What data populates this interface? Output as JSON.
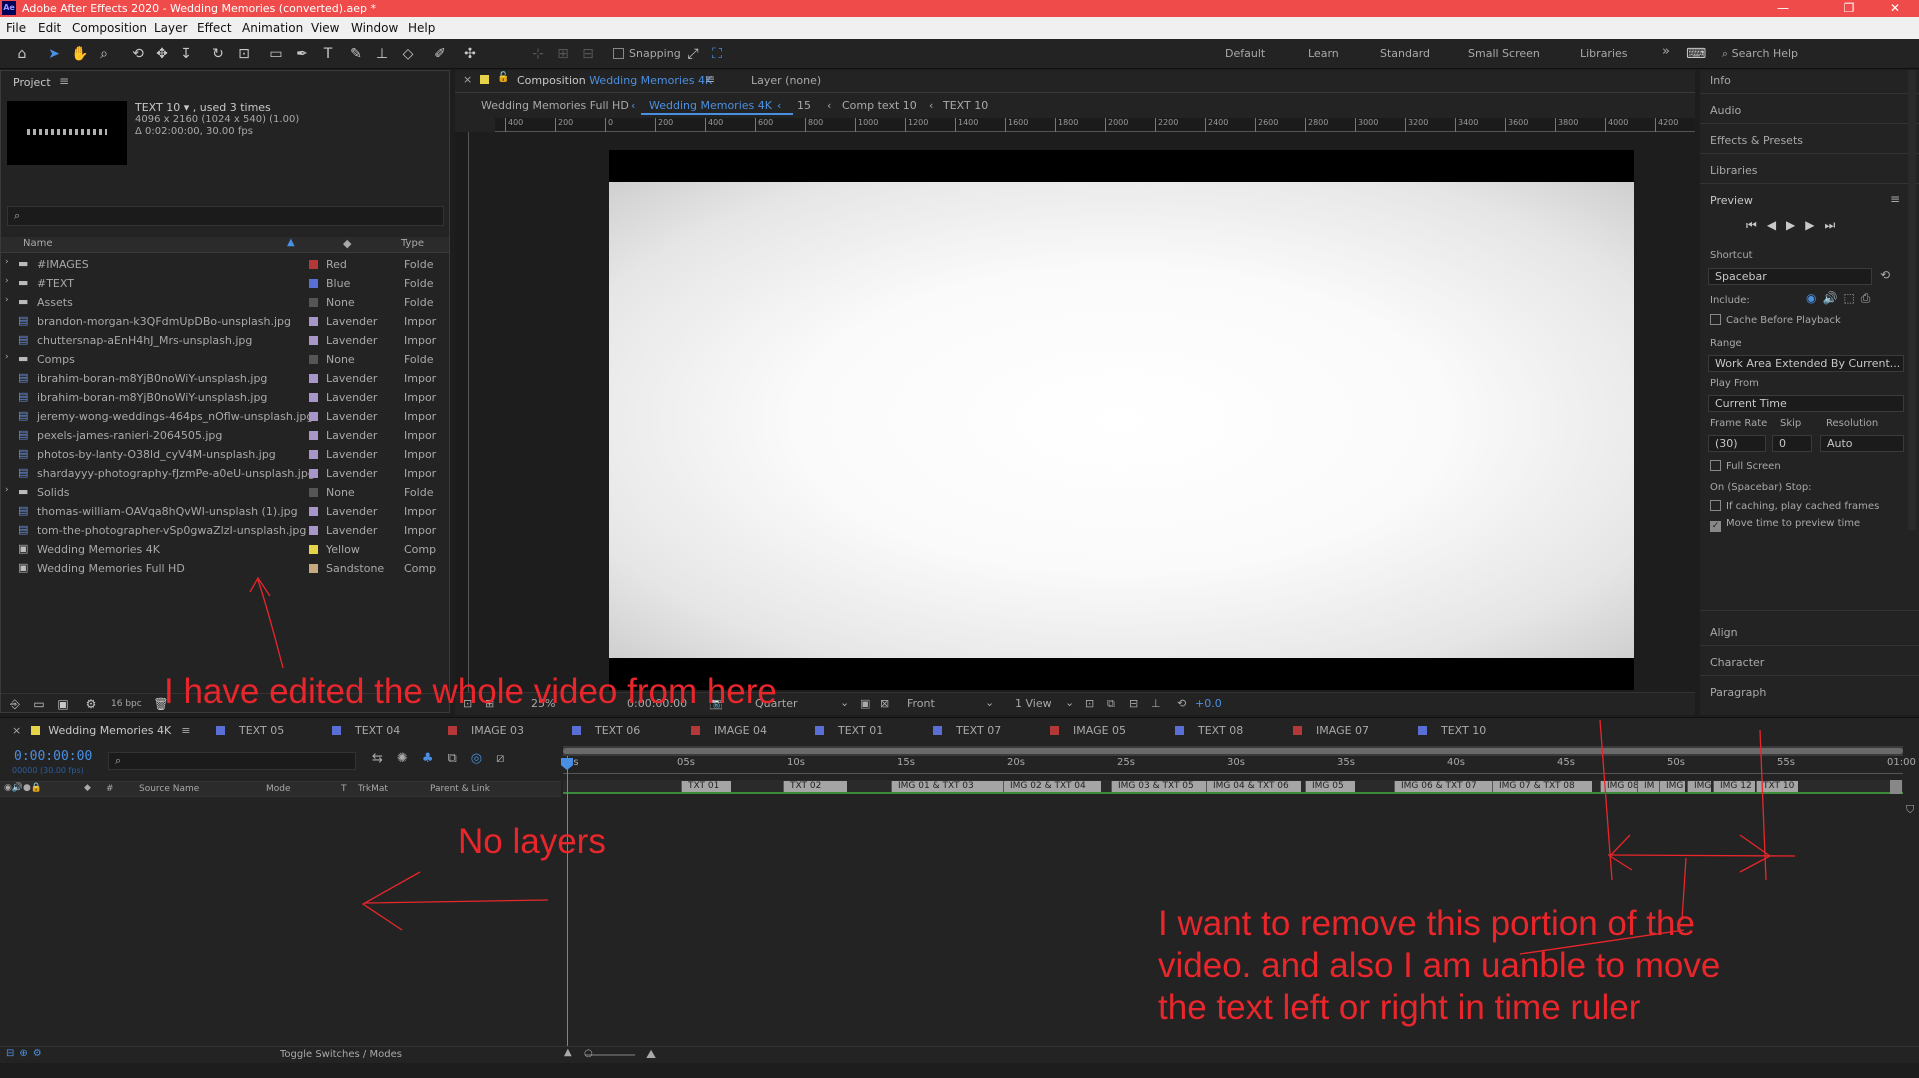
{
  "window": {
    "title": "Adobe After Effects 2020 - Wedding Memories (converted).aep *",
    "app_badge": "Ae",
    "minimize": "—",
    "maximize": "❐",
    "close": "✕"
  },
  "menu": [
    "File",
    "Edit",
    "Composition",
    "Layer",
    "Effect",
    "Animation",
    "View",
    "Window",
    "Help"
  ],
  "toolbar": {
    "snapping_label": "Snapping",
    "workspaces": [
      "Default",
      "Learn",
      "Standard",
      "Small Screen",
      "Libraries"
    ],
    "more": "»",
    "search_placeholder": "Search Help"
  },
  "project": {
    "panel_title": "Project",
    "selected_name": "TEXT 10",
    "selected_used": ", used 3 times",
    "selected_size": "4096 x 2160  (1024 x 540) (1.00)",
    "selected_duration": "Δ 0:02:00:00, 30.00 fps",
    "columns": {
      "name": "Name",
      "type": "Type"
    },
    "items": [
      {
        "name": "#IMAGES",
        "label": "Red",
        "type": "Folde",
        "kind": "folder",
        "color": "#b53838"
      },
      {
        "name": "#TEXT",
        "label": "Blue",
        "type": "Folde",
        "kind": "folder",
        "color": "#5a6fd6"
      },
      {
        "name": "Assets",
        "label": "None",
        "type": "Folde",
        "kind": "folder",
        "color": "#555555"
      },
      {
        "name": "brandon-morgan-k3QFdmUpDBo-unsplash.jpg",
        "label": "Lavender",
        "type": "Impor",
        "kind": "file",
        "color": "#a896c8"
      },
      {
        "name": "chuttersnap-aEnH4hJ_Mrs-unsplash.jpg",
        "label": "Lavender",
        "type": "Impor",
        "kind": "file",
        "color": "#a896c8"
      },
      {
        "name": "Comps",
        "label": "None",
        "type": "Folde",
        "kind": "folder",
        "color": "#555555"
      },
      {
        "name": "ibrahim-boran-m8YjB0noWiY-unsplash.jpg",
        "label": "Lavender",
        "type": "Impor",
        "kind": "file",
        "color": "#a896c8"
      },
      {
        "name": "ibrahim-boran-m8YjB0noWiY-unsplash.jpg",
        "label": "Lavender",
        "type": "Impor",
        "kind": "file",
        "color": "#a896c8"
      },
      {
        "name": "jeremy-wong-weddings-464ps_nOflw-unsplash.jpg",
        "label": "Lavender",
        "type": "Impor",
        "kind": "file",
        "color": "#a896c8"
      },
      {
        "name": "pexels-james-ranieri-2064505.jpg",
        "label": "Lavender",
        "type": "Impor",
        "kind": "file",
        "color": "#a896c8"
      },
      {
        "name": "photos-by-lanty-O38ld_cyV4M-unsplash.jpg",
        "label": "Lavender",
        "type": "Impor",
        "kind": "file",
        "color": "#a896c8"
      },
      {
        "name": "shardayyy-photography-fJzmPe-a0eU-unsplash.jpg",
        "label": "Lavender",
        "type": "Impor",
        "kind": "file",
        "color": "#a896c8"
      },
      {
        "name": "Solids",
        "label": "None",
        "type": "Folde",
        "kind": "folder",
        "color": "#555555"
      },
      {
        "name": "thomas-william-OAVqa8hQvWI-unsplash (1).jpg",
        "label": "Lavender",
        "type": "Impor",
        "kind": "file",
        "color": "#a896c8"
      },
      {
        "name": "tom-the-photographer-vSp0gwaZlzI-unsplash.jpg",
        "label": "Lavender",
        "type": "Impor",
        "kind": "file",
        "color": "#a896c8"
      },
      {
        "name": "Wedding Memories 4K",
        "label": "Yellow",
        "type": "Comp",
        "kind": "comp",
        "color": "#e6d34a"
      },
      {
        "name": "Wedding Memories Full HD",
        "label": "Sandstone",
        "type": "Comp",
        "kind": "comp",
        "color": "#c4aa7e"
      }
    ],
    "bpc": "16 bpc"
  },
  "composition": {
    "tab_label": "Composition",
    "comp_name": "Wedding Memories 4K",
    "layer_label": "Layer (none)",
    "breadcrumbs": [
      "Wedding Memories Full HD",
      "Wedding Memories 4K",
      "15",
      "Comp text 10",
      "TEXT 10"
    ],
    "ruler_ticks": [
      "400",
      "200",
      "0",
      "200",
      "400",
      "600",
      "800",
      "1000",
      "1200",
      "1400",
      "1600",
      "1800",
      "2000",
      "2200",
      "2400",
      "2600",
      "2800",
      "3000",
      "3200",
      "3400",
      "3600",
      "3800",
      "4000",
      "4200"
    ],
    "zoom": "25%",
    "timecode": "0:00:00:00",
    "resolution": "Quarter",
    "view": "Front",
    "views": "1 View",
    "exposure": "+0.0"
  },
  "right_panel": {
    "top_items": [
      "Info",
      "Audio",
      "Effects & Presets",
      "Libraries"
    ],
    "preview_title": "Preview",
    "shortcut_label": "Shortcut",
    "shortcut_value": "Spacebar",
    "include_label": "Include:",
    "cache_label": "Cache Before Playback",
    "range_label": "Range",
    "range_value": "Work Area Extended By Current...",
    "play_from_label": "Play From",
    "play_from_value": "Current Time",
    "frame_rate_label": "Frame Rate",
    "skip_label": "Skip",
    "resolution_label": "Resolution",
    "frame_rate_value": "(30)",
    "skip_value": "0",
    "resolution_value": "Auto",
    "full_screen_label": "Full Screen",
    "stop_label": "On (Spacebar) Stop:",
    "if_caching_label": "If caching, play cached frames",
    "move_time_label": "Move time to preview time",
    "bottom_items": [
      "Align",
      "Character",
      "Paragraph"
    ]
  },
  "timeline": {
    "tabs": [
      {
        "label": "Wedding Memories 4K",
        "color": "#e6d34a",
        "active": true
      },
      {
        "label": "TEXT 05",
        "color": "#5a6fd6"
      },
      {
        "label": "TEXT 04",
        "color": "#5a6fd6"
      },
      {
        "label": "IMAGE 03",
        "color": "#b53838"
      },
      {
        "label": "TEXT 06",
        "color": "#5a6fd6"
      },
      {
        "label": "IMAGE 04",
        "color": "#b53838"
      },
      {
        "label": "TEXT 01",
        "color": "#5a6fd6"
      },
      {
        "label": "TEXT 07",
        "color": "#5a6fd6"
      },
      {
        "label": "IMAGE 05",
        "color": "#b53838"
      },
      {
        "label": "TEXT 08",
        "color": "#5a6fd6"
      },
      {
        "label": "IMAGE 07",
        "color": "#b53838"
      },
      {
        "label": "TEXT 10",
        "color": "#5a6fd6"
      }
    ],
    "timecode": "0:00:00:00",
    "fps_sub": "00000 (30.00 fps)",
    "columns": {
      "hash": "#",
      "source_name": "Source Name",
      "mode": "Mode",
      "t": "T",
      "trkmat": "TrkMat",
      "parent": "Parent & Link"
    },
    "ruler": [
      "0s",
      "05s",
      "10s",
      "15s",
      "20s",
      "25s",
      "30s",
      "35s",
      "40s",
      "45s",
      "50s",
      "55s",
      "01:00"
    ],
    "markers": [
      "TXT 01",
      "TXT 02",
      "IMG 01 & TXT 03",
      "IMG 02 & TXT 04",
      "IMG 03 & TXT 05",
      "IMG 04 & TXT 06",
      "IMG 05",
      "IMG 06 & TXT 07",
      "IMG 07 & TXT 08",
      "IMG 08",
      "IM",
      "IMG",
      "IMG",
      "IMG 12",
      "TXT 10"
    ],
    "toggle_label": "Toggle Switches / Modes"
  },
  "annotations": {
    "edited": "I have edited the whole video from here",
    "no_layers": "No layers",
    "remove_line1": "I want to remove this portion of the",
    "remove_line2": "video. and also I am uanble to move",
    "remove_line3": "the text left or right in time ruler"
  }
}
